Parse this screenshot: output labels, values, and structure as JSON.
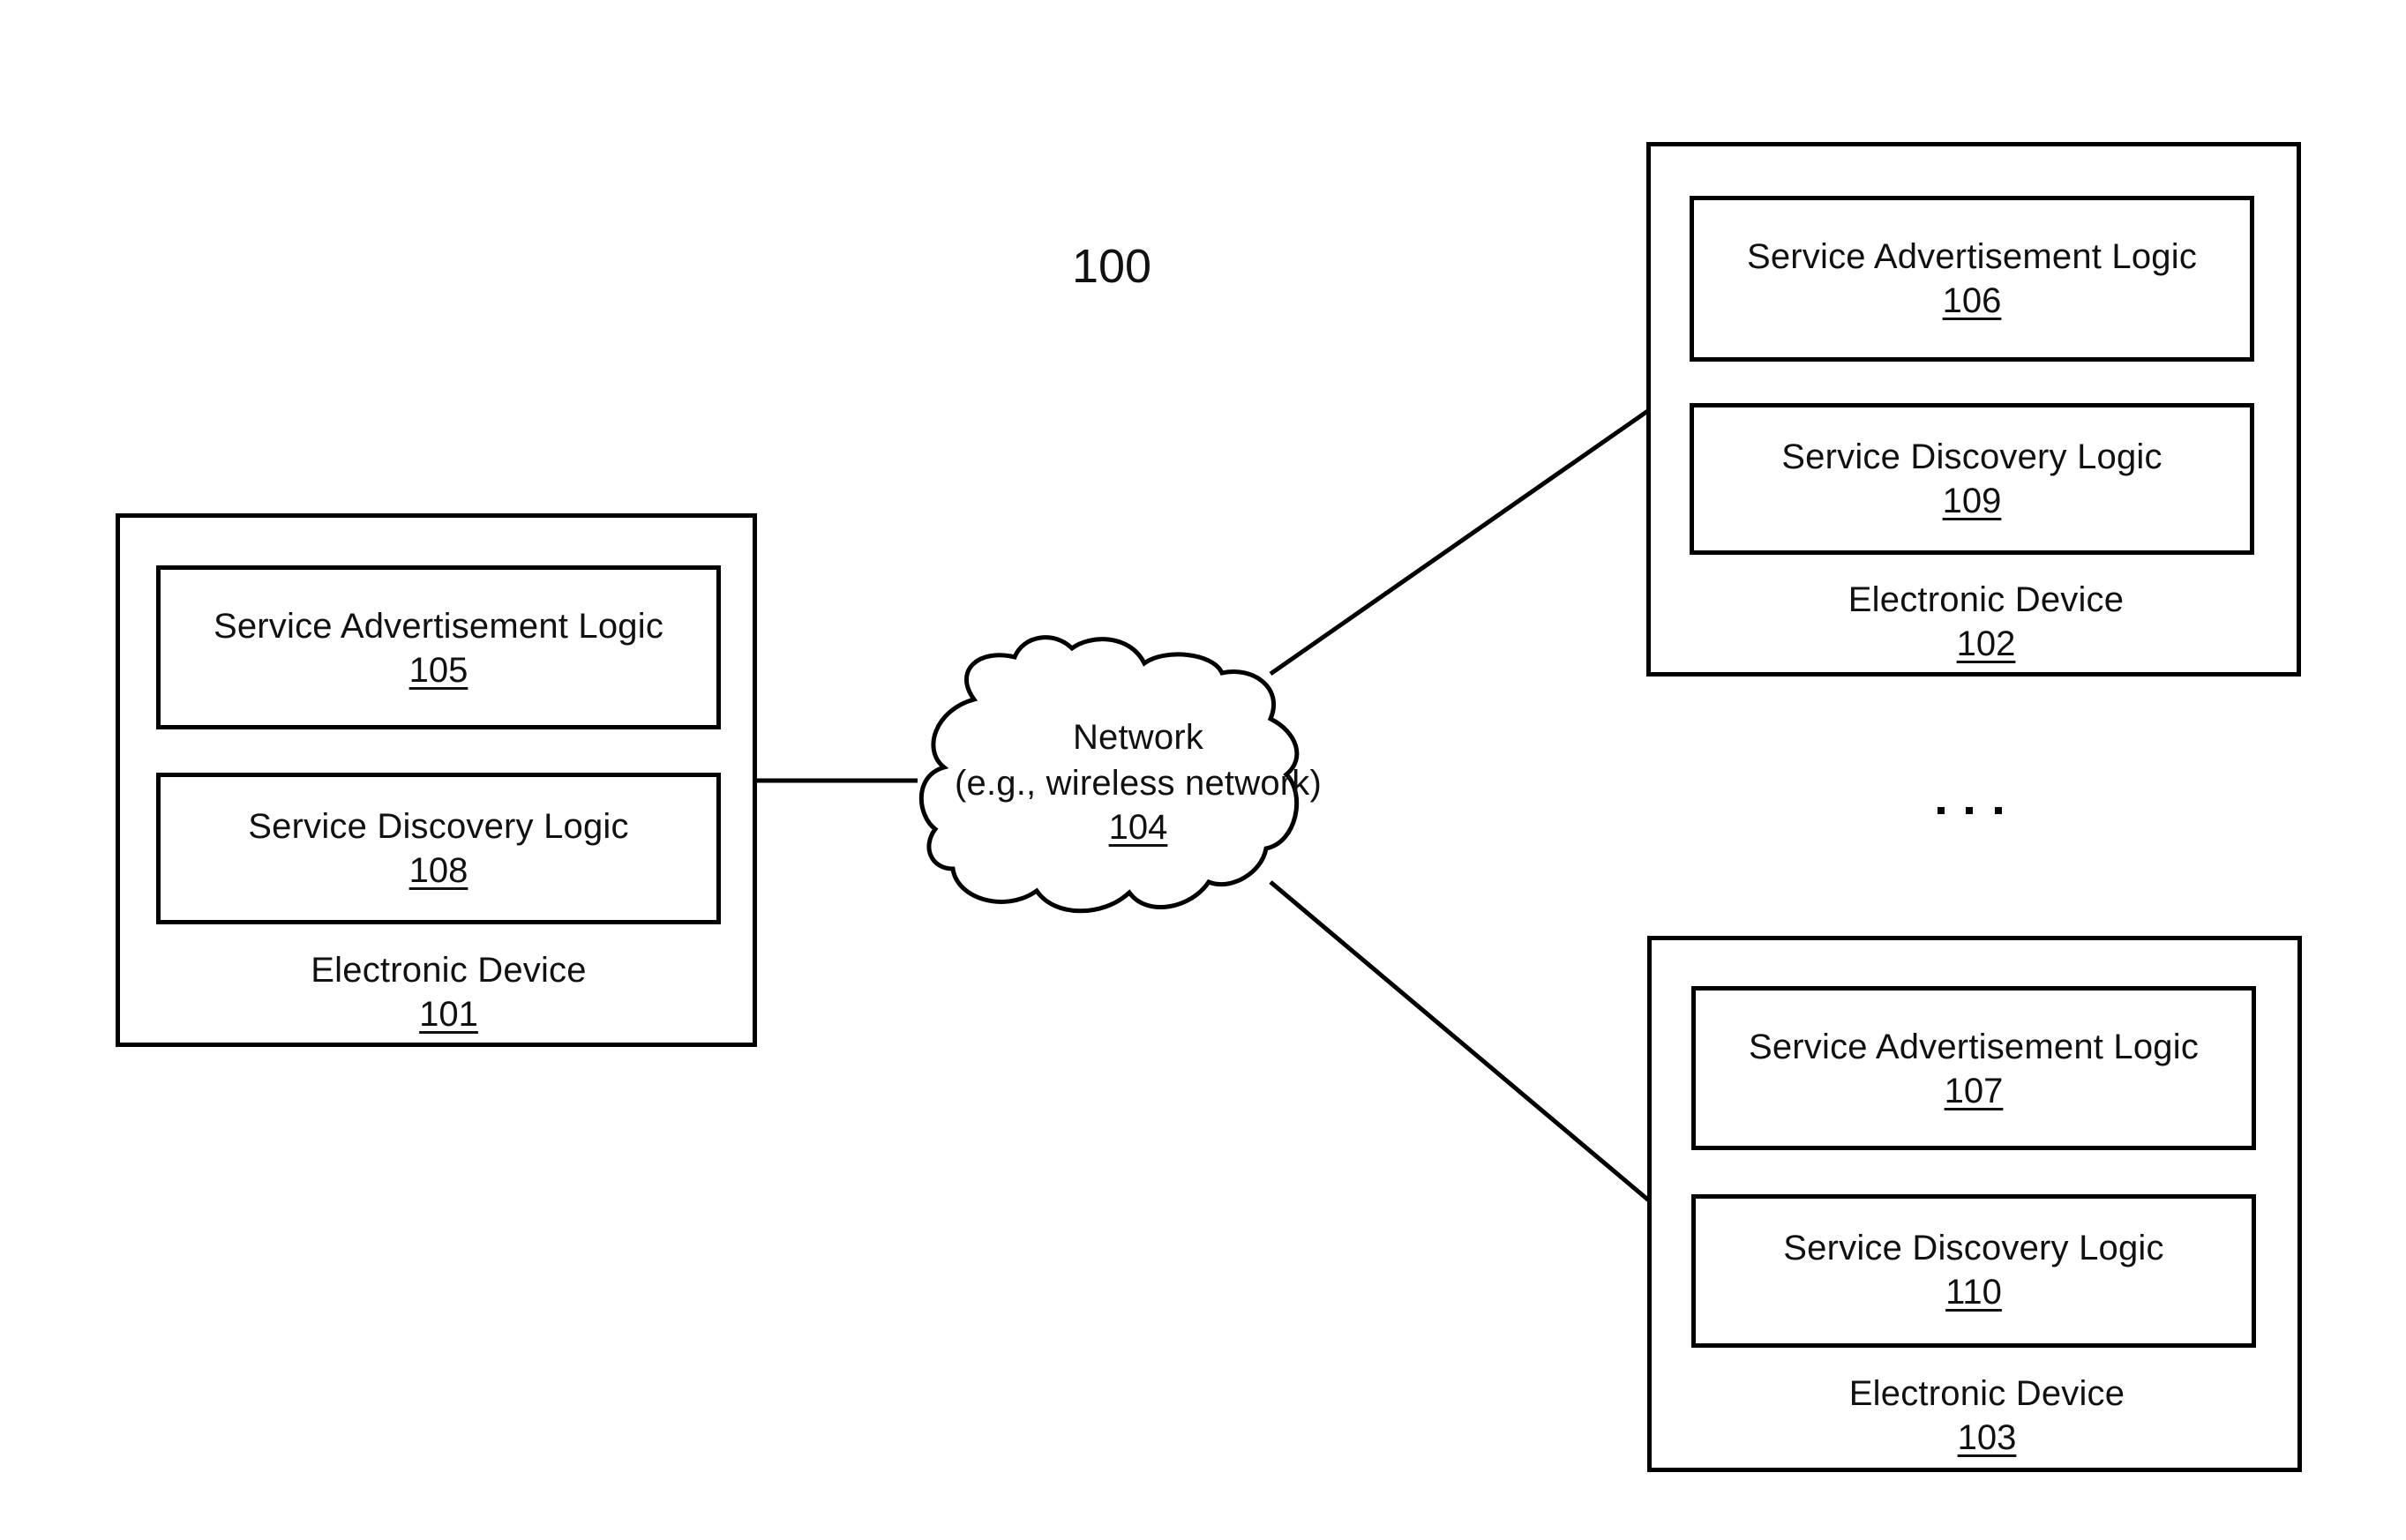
{
  "figure": {
    "label": "100"
  },
  "network": {
    "title": "Network",
    "subtitle": "(e.g., wireless network)",
    "ref": "104"
  },
  "devices": [
    {
      "name": "Electronic Device",
      "ref": "101",
      "advertisement": {
        "name": "Service Advertisement Logic",
        "ref": "105"
      },
      "discovery": {
        "name": "Service Discovery Logic",
        "ref": "108"
      }
    },
    {
      "name": "Electronic Device",
      "ref": "102",
      "advertisement": {
        "name": "Service Advertisement Logic",
        "ref": "106"
      },
      "discovery": {
        "name": "Service Discovery Logic",
        "ref": "109"
      }
    },
    {
      "name": "Electronic Device",
      "ref": "103",
      "advertisement": {
        "name": "Service Advertisement Logic",
        "ref": "107"
      },
      "discovery": {
        "name": "Service Discovery Logic",
        "ref": "110"
      }
    }
  ],
  "ellipsis": "..."
}
